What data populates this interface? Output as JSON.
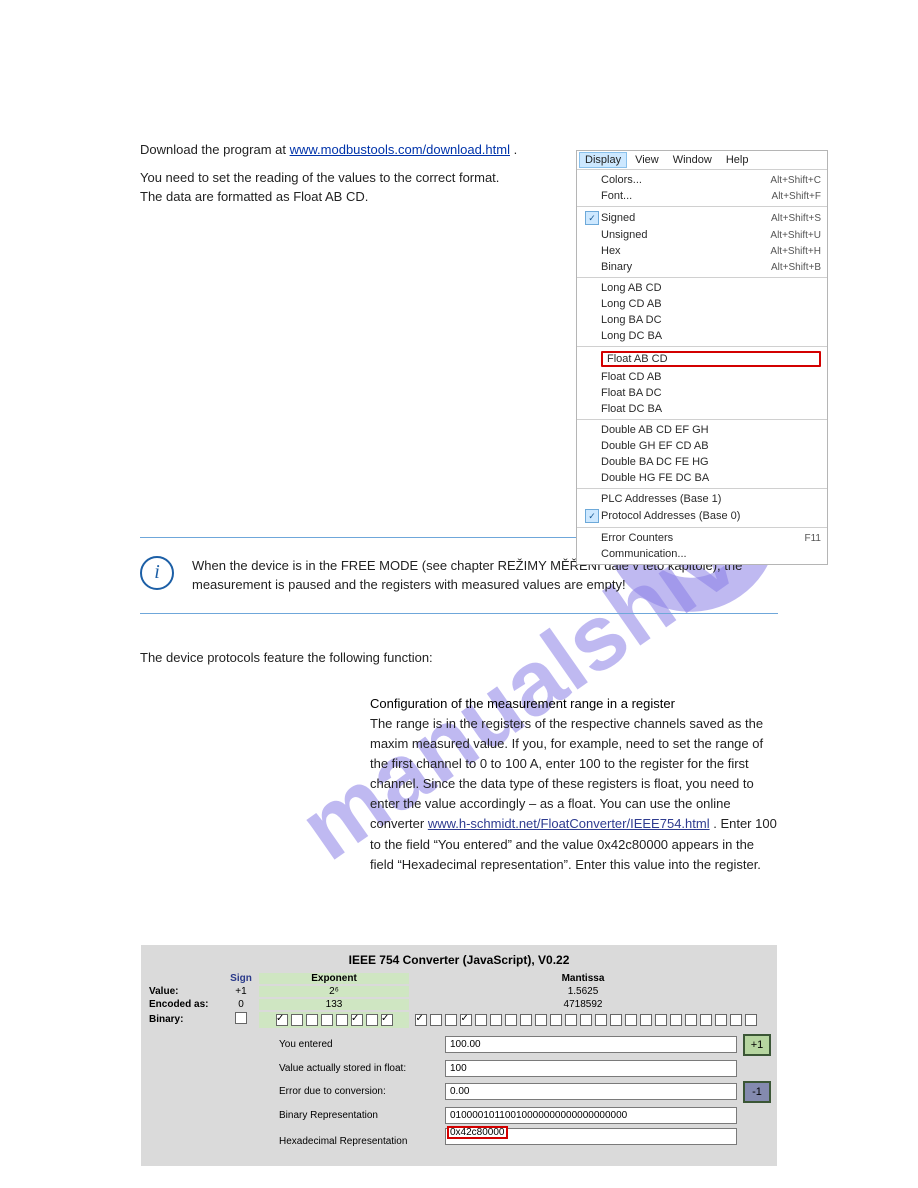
{
  "intro": {
    "p1_pre": "Download the program at ",
    "p1_link": "www.modbustools.com/download.html",
    "p1_post": ".",
    "p2": "You need to set the reading of the values to the correct format. The data are formatted as Float AB CD."
  },
  "menu": {
    "bar": {
      "display": "Display",
      "view": "View",
      "window": "Window",
      "help": "Help"
    },
    "g1": [
      {
        "label": "Colors...",
        "shortcut": "Alt+Shift+C"
      },
      {
        "label": "Font...",
        "shortcut": "Alt+Shift+F"
      }
    ],
    "g2": [
      {
        "label": "Signed",
        "shortcut": "Alt+Shift+S",
        "checked": true
      },
      {
        "label": "Unsigned",
        "shortcut": "Alt+Shift+U"
      },
      {
        "label": "Hex",
        "shortcut": "Alt+Shift+H"
      },
      {
        "label": "Binary",
        "shortcut": "Alt+Shift+B"
      }
    ],
    "g3": [
      {
        "label": "Long AB CD"
      },
      {
        "label": "Long CD AB"
      },
      {
        "label": "Long BA DC"
      },
      {
        "label": "Long DC BA"
      }
    ],
    "g4": [
      {
        "label": "Float AB CD",
        "highlight": true
      },
      {
        "label": "Float CD AB"
      },
      {
        "label": "Float BA DC"
      },
      {
        "label": "Float DC BA"
      }
    ],
    "g5": [
      {
        "label": "Double AB CD EF GH"
      },
      {
        "label": "Double GH EF CD AB"
      },
      {
        "label": "Double BA DC FE HG"
      },
      {
        "label": "Double HG FE DC BA"
      }
    ],
    "g6": [
      {
        "label": "PLC Addresses (Base 1)"
      },
      {
        "label": "Protocol Addresses (Base 0)",
        "checked": true
      }
    ],
    "g7": [
      {
        "label": "Error Counters",
        "shortcut": "F11"
      },
      {
        "label": "Communication..."
      }
    ]
  },
  "note": "When the device is in the FREE MODE (see chapter REŽIMY MĚŘENÍ dále v této kapitole), the measurement is paused and the registers with measured values are empty!",
  "sec2": {
    "lead": "The device protocols feature the following function:",
    "heading": "Configuration of the measurement range in a register",
    "body_a": "The range is in the registers of the respective channels saved as the maxim measured value. If you, for example, need to set the range of the first channel to 0 to 100 A, enter 100 to the register for the first channel. Since the data type of these registers is float, you need to enter the value accordingly – as a float. You can use the online converter ",
    "body_link": "www.h-schmidt.net/FloatConverter/IEEE754.html",
    "body_b": ". Enter 100 to the field “You entered” and the value 0x42c80000 appears in the field “Hexadecimal representation”. Enter this value into the register."
  },
  "ieee": {
    "title": "IEEE 754 Converter (JavaScript), V0.22",
    "hdr_sign": "Sign",
    "hdr_exp": "Exponent",
    "hdr_man": "Mantissa",
    "row_value": "Value:",
    "row_encoded": "Encoded as:",
    "row_binary": "Binary:",
    "val_sign": "+1",
    "val_exp": "2⁶",
    "val_man": "1.5625",
    "enc_sign": "0",
    "enc_exp": "133",
    "enc_man": "4718592",
    "form": {
      "you_entered_lbl": "You entered",
      "you_entered_val": "100.00",
      "stored_lbl": "Value actually stored in float:",
      "stored_val": "100",
      "error_lbl": "Error due to conversion:",
      "error_val": "0.00",
      "bin_lbl": "Binary Representation",
      "bin_val": "01000010110010000000000000000000",
      "hex_lbl": "Hexadecimal Representation",
      "hex_val": "0x42c80000",
      "plus": "+1",
      "minus": "-1"
    }
  }
}
